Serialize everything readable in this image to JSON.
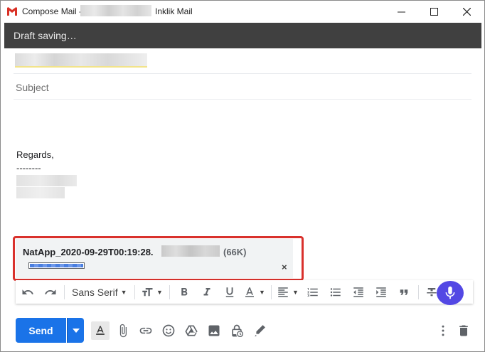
{
  "window": {
    "title_prefix": "Compose Mail - ",
    "title_suffix": "Inklik Mail",
    "min_glyph": "—",
    "max_glyph": "☐",
    "close_glyph": "✕"
  },
  "draft_status": "Draft saving…",
  "compose": {
    "subject_placeholder": "Subject",
    "body_line1": "Regards,",
    "body_line2": "--------"
  },
  "attachment": {
    "filename": "NatApp_2020-09-29T00:19:28.",
    "size": "(66K)",
    "remove_glyph": "×",
    "upload_progress": 1.0
  },
  "toolbar": {
    "font_name": "Sans Serif"
  },
  "bottom": {
    "send_label": "Send"
  },
  "colors": {
    "accent": "#1a73e8",
    "highlight": "#d9312c",
    "mic": "#5348e4",
    "draftbar": "#404040"
  }
}
